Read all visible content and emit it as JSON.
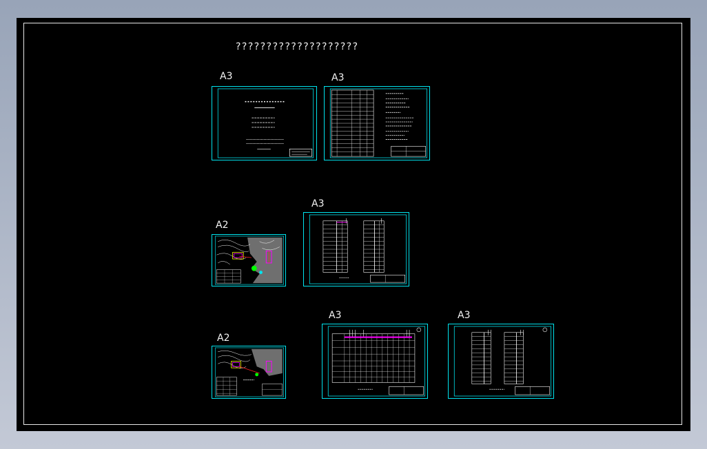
{
  "drawing": {
    "title": "????????????????????",
    "sheets": [
      {
        "id": "cover",
        "size_label": "A3"
      },
      {
        "id": "index",
        "size_label": "A3"
      },
      {
        "id": "plan-1",
        "size_label": "A2"
      },
      {
        "id": "table-1",
        "size_label": "A3"
      },
      {
        "id": "plan-2",
        "size_label": "A2"
      },
      {
        "id": "grid-1",
        "size_label": "A3"
      },
      {
        "id": "table-2",
        "size_label": "A3"
      }
    ]
  },
  "colors": {
    "background": "#000000",
    "frame": "#00e5f0",
    "lines": "#ffffff",
    "accent_magenta": "#ff00ff",
    "accent_green": "#00ff00",
    "accent_red": "#ff2020",
    "accent_yellow": "#ffff00"
  }
}
